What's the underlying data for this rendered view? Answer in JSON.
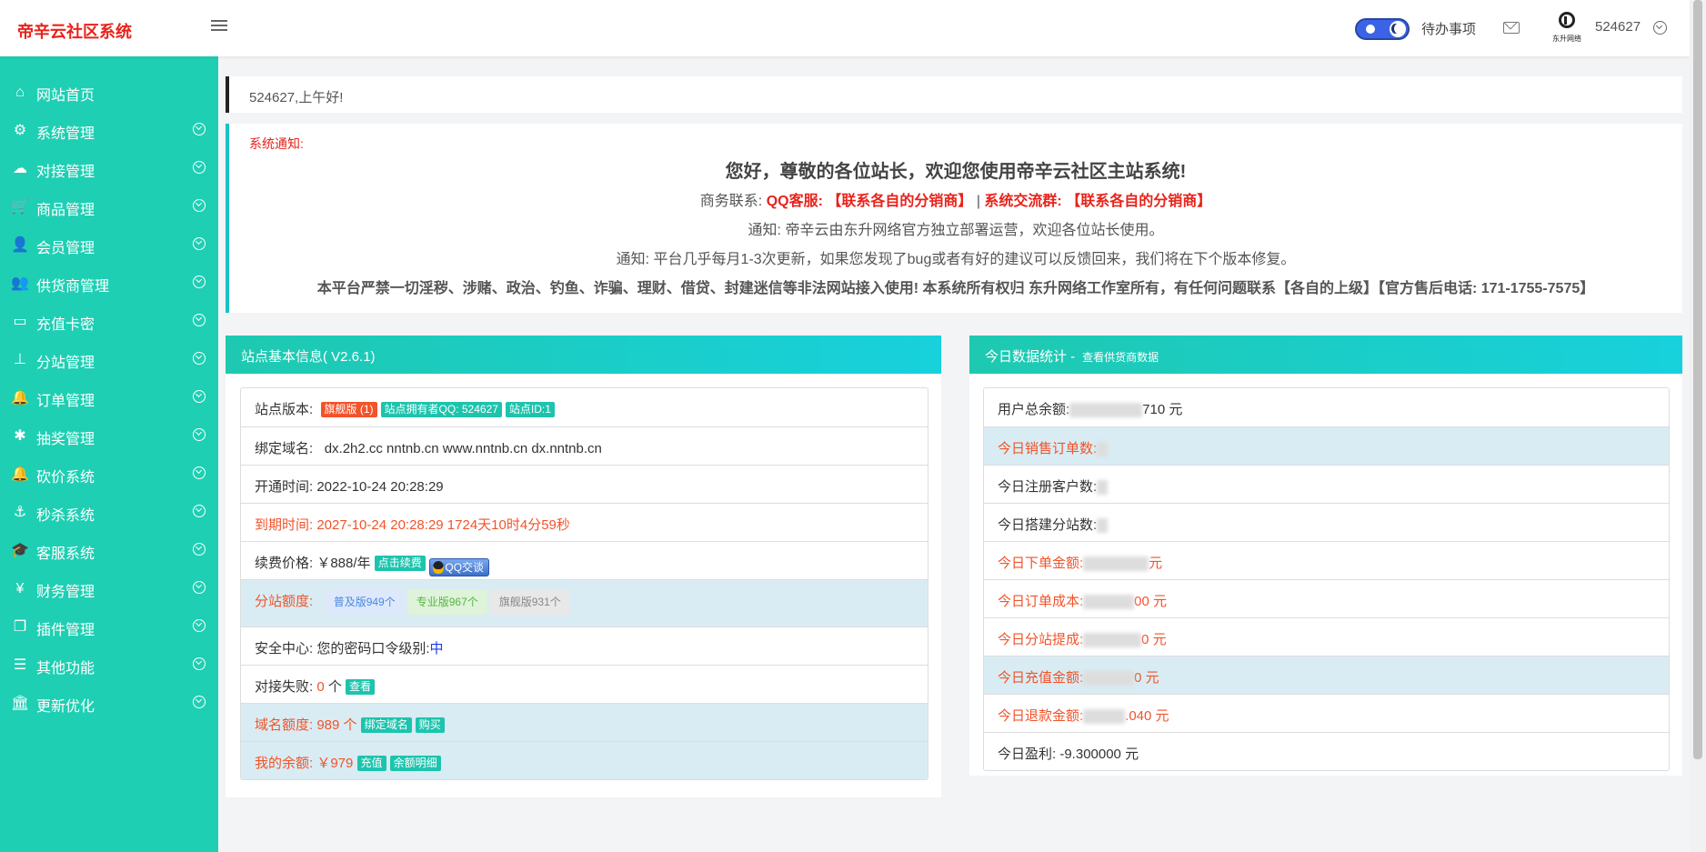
{
  "header": {
    "brand": "帝辛云社区系统",
    "todo_label": "待办事项",
    "logo_text": "东升网络",
    "username": "524627"
  },
  "sidebar": {
    "items": [
      {
        "label": "网站首页",
        "icon": "home-icon",
        "glyph": "⌂",
        "expandable": false
      },
      {
        "label": "系统管理",
        "icon": "gears-icon",
        "glyph": "⚙",
        "expandable": true
      },
      {
        "label": "对接管理",
        "icon": "cloud-icon",
        "glyph": "☁",
        "expandable": true
      },
      {
        "label": "商品管理",
        "icon": "cart-icon",
        "glyph": "🛒",
        "expandable": true
      },
      {
        "label": "会员管理",
        "icon": "user-icon",
        "glyph": "👤",
        "expandable": true
      },
      {
        "label": "供货商管理",
        "icon": "users-icon",
        "glyph": "👥",
        "expandable": true
      },
      {
        "label": "充值卡密",
        "icon": "credit-card-icon",
        "glyph": "▭",
        "expandable": true
      },
      {
        "label": "分站管理",
        "icon": "sitemap-icon",
        "glyph": "⊥",
        "expandable": true
      },
      {
        "label": "订单管理",
        "icon": "bell-icon",
        "glyph": "🔔",
        "expandable": true
      },
      {
        "label": "抽奖管理",
        "icon": "asterisk-icon",
        "glyph": "✱",
        "expandable": true
      },
      {
        "label": "砍价系统",
        "icon": "bell-icon",
        "glyph": "🔔",
        "expandable": true
      },
      {
        "label": "秒杀系统",
        "icon": "anchor-icon",
        "glyph": "⚓",
        "expandable": true
      },
      {
        "label": "客服系统",
        "icon": "graduation-cap-icon",
        "glyph": "🎓",
        "expandable": true
      },
      {
        "label": "财务管理",
        "icon": "yen-icon",
        "glyph": "¥",
        "expandable": true
      },
      {
        "label": "插件管理",
        "icon": "copy-icon",
        "glyph": "❐",
        "expandable": true
      },
      {
        "label": "其他功能",
        "icon": "server-icon",
        "glyph": "☰",
        "expandable": true
      },
      {
        "label": "更新优化",
        "icon": "bank-icon",
        "glyph": "🏛",
        "expandable": true
      }
    ]
  },
  "greeting": "524627,上午好!",
  "notice": {
    "title": "系统通知:",
    "line1": "您好，尊敬的各位站长，欢迎您使用帝辛云社区主站系统!",
    "line2_prefix": "商务联系: ",
    "line2_qq": "QQ客服: 【联系各自的分销商】",
    "line2_sep": " | ",
    "line2_group": "系统交流群: 【联系各自的分销商】",
    "line3": "通知: 帝辛云由东升网络官方独立部署运营，欢迎各位站长使用。",
    "line4": "通知: 平台几乎每月1-3次更新，如果您发现了bug或者有好的建议可以反馈回来，我们将在下个版本修复。",
    "line5": "本平台严禁一切淫秽、涉赌、政治、钓鱼、诈骗、理财、借贷、封建迷信等非法网站接入使用! 本系统所有权归 东升网络工作室所有，有任何问题联系【各自的上级】【官方售后电话: 171-1755-7575】"
  },
  "site_info": {
    "title": "站点基本信息( V2.6.1)",
    "version_label": "站点版本:",
    "version_tag": "旗舰版 (1)",
    "owner_tag": "站点拥有者QQ: 524627",
    "id_tag": "站点ID:1",
    "domain_label": "绑定域名:",
    "domain_value": "dx.2h2.cc nntnb.cn www.nntnb.cn dx.nntnb.cn",
    "open_label": "开通时间:",
    "open_value": "2022-10-24 20:28:29",
    "expire_label": "到期时间:",
    "expire_value": "2027-10-24 20:28:29 1724天10时4分59秒",
    "renew_label": "续费价格:",
    "renew_value": "￥888/年",
    "renew_button": "点击续费",
    "qq_button": "QQ交谈",
    "quota_label": "分站额度:",
    "quota_basic": "普及版949个",
    "quota_pro": "专业版967个",
    "quota_flagship": "旗舰版931个",
    "security_label": "安全中心:",
    "security_text": "您的密码口令级别:",
    "security_level": "中",
    "dock_fail_label": "对接失败:",
    "dock_fail_count": "0",
    "dock_fail_unit": "个",
    "dock_fail_button": "查看",
    "domain_quota_label": "域名额度:",
    "domain_quota_value": "989 个",
    "bind_domain_button": "绑定域名",
    "buy_button": "购买",
    "balance_label": "我的余额:",
    "balance_value": "￥979",
    "recharge_button": "充值",
    "balance_detail_button": "余额明细"
  },
  "today_stats": {
    "title": "今日数据统计 -",
    "link": "查看供货商数据",
    "rows": [
      {
        "label": "用户总余额:",
        "visible_value": "710 元",
        "orange": false,
        "highlight": false,
        "blur": 80
      },
      {
        "label": "今日销售订单数:",
        "visible_value": "",
        "orange": true,
        "highlight": true,
        "blur": 12
      },
      {
        "label": "今日注册客户数:",
        "visible_value": "",
        "orange": false,
        "highlight": false,
        "blur": 12
      },
      {
        "label": "今日搭建分站数:",
        "visible_value": "",
        "orange": false,
        "highlight": false,
        "blur": 12
      },
      {
        "label": "今日下单金额:",
        "visible_value": "元",
        "orange": true,
        "highlight": false,
        "blur": 72
      },
      {
        "label": "今日订单成本:",
        "visible_value": "00 元",
        "orange": true,
        "highlight": false,
        "blur": 56
      },
      {
        "label": "今日分站提成:",
        "visible_value": "0 元",
        "orange": true,
        "highlight": false,
        "blur": 64
      },
      {
        "label": "今日充值金额:",
        "visible_value": "0 元",
        "orange": true,
        "highlight": true,
        "blur": 56
      },
      {
        "label": "今日退款金额:",
        "visible_value": ".040 元",
        "orange": true,
        "highlight": false,
        "blur": 46
      },
      {
        "label": "今日盈利:",
        "visible_value": "-9.300000 元",
        "orange": false,
        "highlight": false,
        "blur": 0
      }
    ]
  },
  "colors": {
    "sidebar": "#1ecfb3",
    "brand": "#e8231b",
    "accent_orange": "#f2532a",
    "row_highlight": "#d9ecf3"
  }
}
